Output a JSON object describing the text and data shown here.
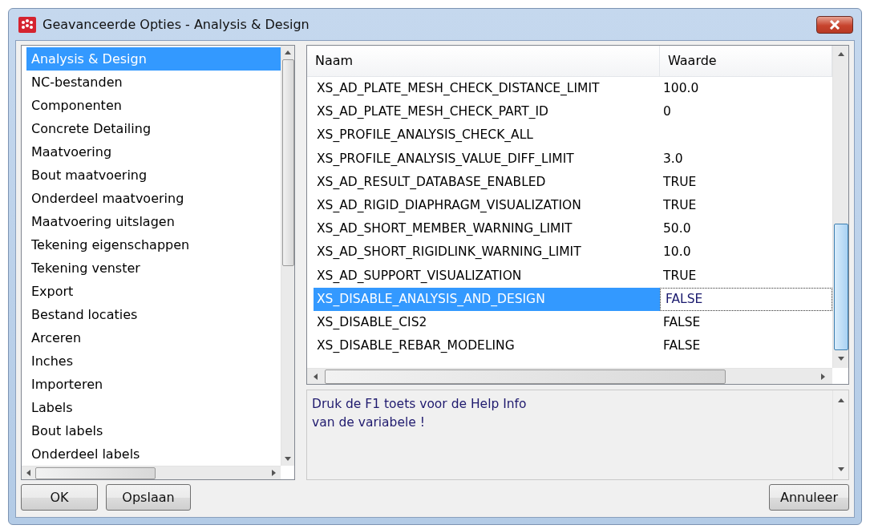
{
  "window": {
    "title": "Geavanceerde Opties - Analysis & Design"
  },
  "categories": [
    {
      "label": "Analysis & Design",
      "selected": true
    },
    {
      "label": "NC-bestanden",
      "selected": false
    },
    {
      "label": "Componenten",
      "selected": false
    },
    {
      "label": "Concrete Detailing",
      "selected": false
    },
    {
      "label": "Maatvoering",
      "selected": false
    },
    {
      "label": "Bout maatvoering",
      "selected": false
    },
    {
      "label": "Onderdeel maatvoering",
      "selected": false
    },
    {
      "label": "Maatvoering uitslagen",
      "selected": false
    },
    {
      "label": "Tekening eigenschappen",
      "selected": false
    },
    {
      "label": "Tekening venster",
      "selected": false
    },
    {
      "label": "Export",
      "selected": false
    },
    {
      "label": "Bestand locaties",
      "selected": false
    },
    {
      "label": "Arceren",
      "selected": false
    },
    {
      "label": "Inches",
      "selected": false
    },
    {
      "label": "Importeren",
      "selected": false
    },
    {
      "label": "Labels",
      "selected": false
    },
    {
      "label": "Bout labels",
      "selected": false
    },
    {
      "label": "Onderdeel labels",
      "selected": false
    }
  ],
  "table": {
    "columns": [
      "Naam",
      "Waarde"
    ],
    "rows": [
      {
        "name": "XS_AD_PLATE_MESH_CHECK_DISTANCE_LIMIT",
        "value": "100.0",
        "selected": false
      },
      {
        "name": "XS_AD_PLATE_MESH_CHECK_PART_ID",
        "value": "0",
        "selected": false
      },
      {
        "name": "XS_PROFILE_ANALYSIS_CHECK_ALL",
        "value": "",
        "selected": false
      },
      {
        "name": "XS_PROFILE_ANALYSIS_VALUE_DIFF_LIMIT",
        "value": "3.0",
        "selected": false
      },
      {
        "name": "XS_AD_RESULT_DATABASE_ENABLED",
        "value": "TRUE",
        "selected": false
      },
      {
        "name": "XS_AD_RIGID_DIAPHRAGM_VISUALIZATION",
        "value": "TRUE",
        "selected": false
      },
      {
        "name": "XS_AD_SHORT_MEMBER_WARNING_LIMIT",
        "value": "50.0",
        "selected": false
      },
      {
        "name": "XS_AD_SHORT_RIGIDLINK_WARNING_LIMIT",
        "value": "10.0",
        "selected": false
      },
      {
        "name": "XS_AD_SUPPORT_VISUALIZATION",
        "value": "TRUE",
        "selected": false
      },
      {
        "name": "XS_DISABLE_ANALYSIS_AND_DESIGN",
        "value": "FALSE",
        "selected": true
      },
      {
        "name": "XS_DISABLE_CIS2",
        "value": "FALSE",
        "selected": false
      },
      {
        "name": "XS_DISABLE_REBAR_MODELING",
        "value": "FALSE",
        "selected": false
      }
    ]
  },
  "help": {
    "lines": [
      "Druk de F1 toets voor de Help Info",
      "van de variabele !"
    ]
  },
  "buttons": {
    "ok": "OK",
    "save": "Opslaan",
    "cancel": "Annuleer"
  }
}
